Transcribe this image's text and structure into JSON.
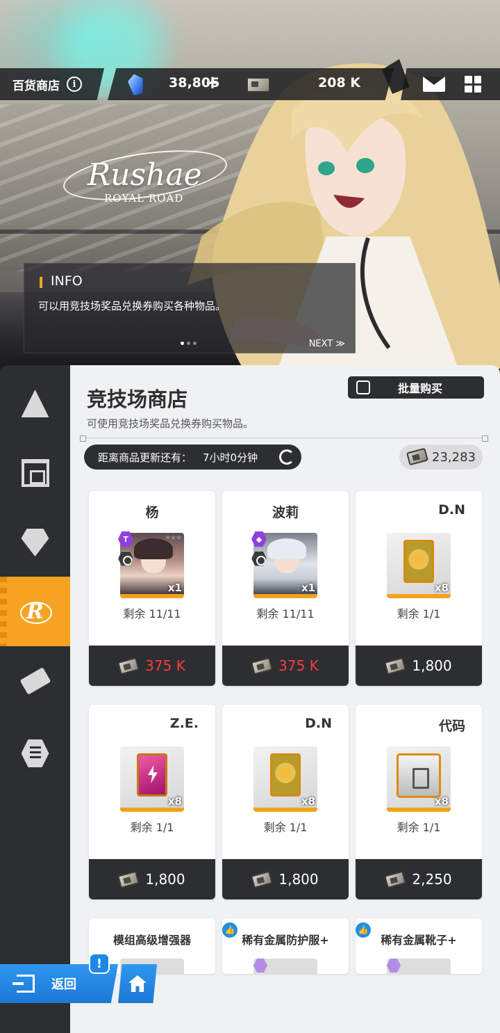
{
  "topbar": {
    "title": "百货商店",
    "info_icon": "info-icon",
    "gems": "38,805",
    "gems_plus": "+",
    "tickets": "208 K",
    "icons": [
      "gem-icon",
      "ticket-icon",
      "mail-icon",
      "grid-menu-icon"
    ]
  },
  "banner": {
    "logo_name": "Rushae",
    "logo_sub": "ROYAL ROAD",
    "info_title": "INFO",
    "info_text": "可以用竞技场奖品兑换券购买各种物品。",
    "next_label": "NEXT ≫",
    "page_indicator": {
      "count": 3,
      "active": 0
    }
  },
  "sidebar": {
    "items": [
      {
        "icon": "pyramid-icon",
        "active": false
      },
      {
        "icon": "shop-icon",
        "active": false
      },
      {
        "icon": "diamond-icon",
        "active": false
      },
      {
        "icon": "arena-r-icon",
        "label": "R",
        "active": true
      },
      {
        "icon": "tickets-icon",
        "active": false
      },
      {
        "icon": "hex-token-icon",
        "active": false
      }
    ]
  },
  "shop": {
    "title": "竞技场商店",
    "description": "可使用竞技场奖品兑换券购买物品。",
    "bulk_buy_label": "批量购买",
    "refresh_label": "距离商品更新还有：",
    "refresh_time": "7小时0分钟",
    "balance": "23,283",
    "items": [
      {
        "name": "杨",
        "qty": "x1",
        "remaining": "剩余 11/11",
        "price": "375 K",
        "price_red": true,
        "type": "portrait"
      },
      {
        "name": "波莉",
        "qty": "x1",
        "remaining": "剩余 11/11",
        "price": "375 K",
        "price_red": true,
        "type": "portrait"
      },
      {
        "name": "D.N",
        "qty": "x8",
        "remaining": "剩余 1/1",
        "price": "1,800",
        "price_red": false,
        "type": "chip-orange"
      },
      {
        "name": "Z.E.",
        "qty": "x8",
        "remaining": "剩余 1/1",
        "price": "1,800",
        "price_red": false,
        "type": "chip-pink"
      },
      {
        "name": "D.N",
        "qty": "x8",
        "remaining": "剩余 1/1",
        "price": "1,800",
        "price_red": false,
        "type": "chip-orange"
      },
      {
        "name": "代码",
        "qty": "x8",
        "remaining": "剩余 1/1",
        "price": "2,250",
        "price_red": false,
        "type": "crate"
      },
      {
        "name": "模组高级增强器",
        "type": "partial"
      },
      {
        "name": "稀有金属防护服+",
        "type": "partial",
        "liked": true
      },
      {
        "name": "稀有金属靴子+",
        "type": "partial",
        "liked": true
      }
    ],
    "badge_letter": "T"
  },
  "bottom": {
    "back_label": "返回",
    "alert": "!"
  }
}
